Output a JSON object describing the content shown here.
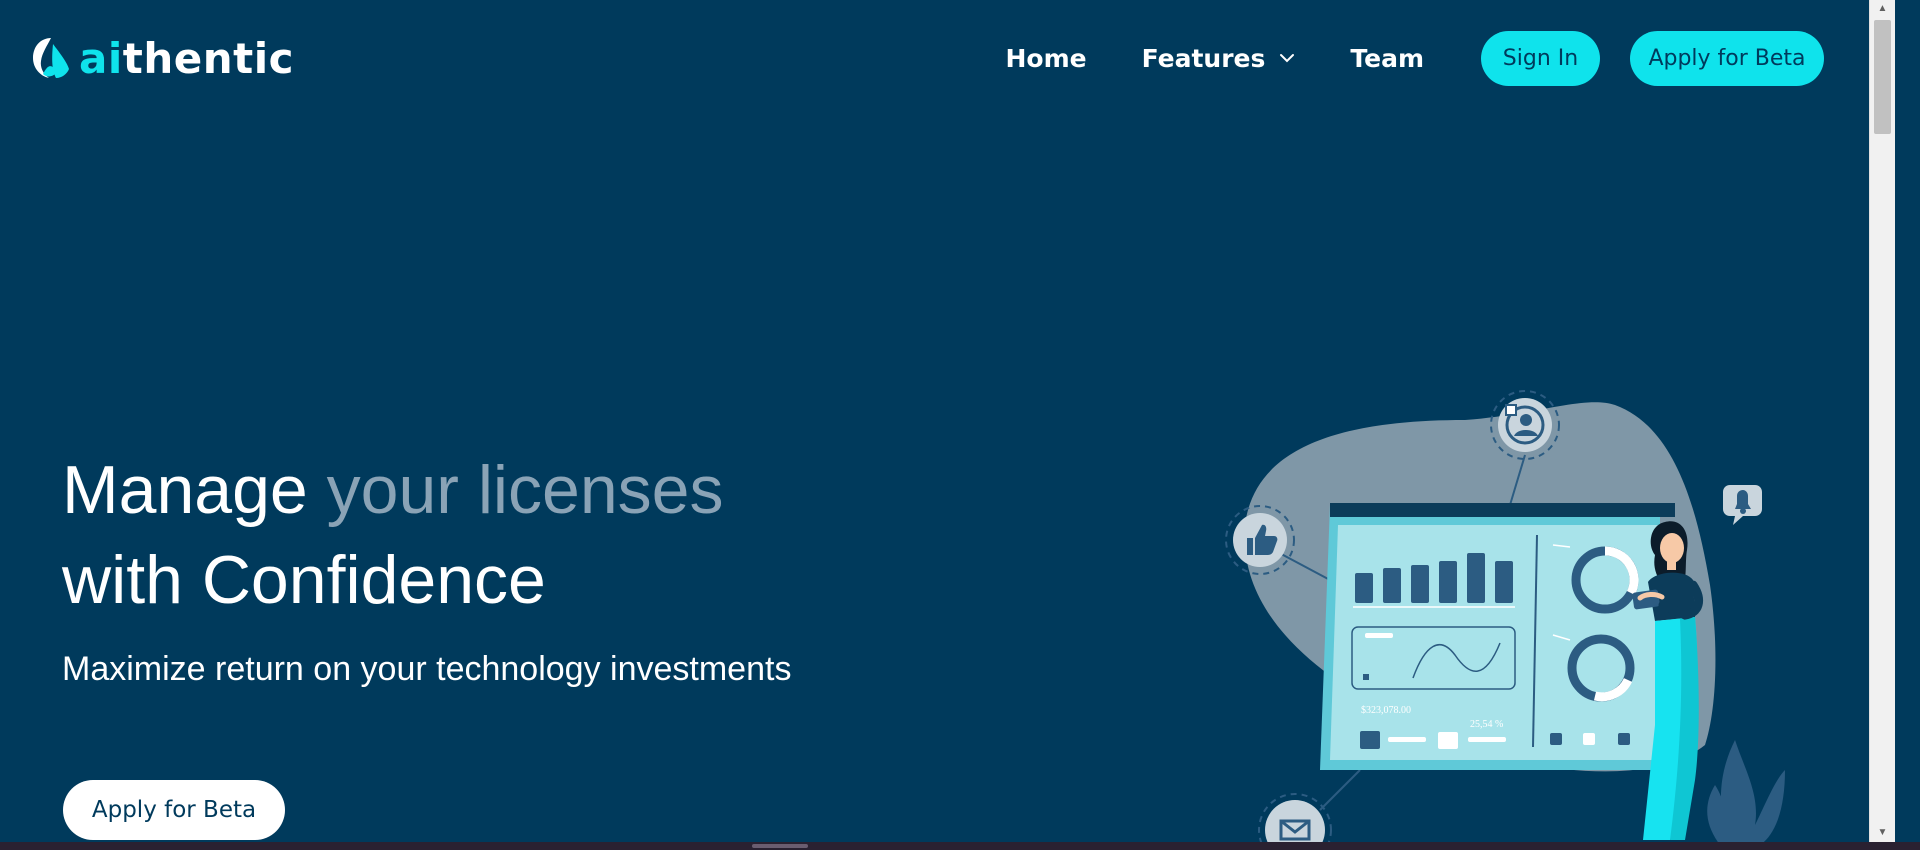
{
  "brand": {
    "name_prefix": "ai",
    "name_suffix": "thentic",
    "logo_icon": "aithentic-logo-icon"
  },
  "nav": {
    "items": [
      {
        "label": "Home"
      },
      {
        "label": "Features",
        "icon": "chevron-down-icon"
      },
      {
        "label": "Team"
      }
    ],
    "signin_label": "Sign In",
    "apply_label": "Apply for Beta"
  },
  "hero": {
    "title_start": "Manage ",
    "title_highlight": "your licenses",
    "title_end": "with Confidence",
    "subtitle": "Maximize return on your technology investments",
    "cta_label": "Apply for Beta"
  },
  "illustration": {
    "amount": "$323,078.00",
    "percent": "25,54 %",
    "icons": [
      "like-icon",
      "user-profile-icon",
      "bell-icon",
      "mail-icon",
      "plant-icon"
    ]
  },
  "colors": {
    "background": "#003a5c",
    "accent": "#0fe3ec",
    "muted_text": "#8aa3b6"
  }
}
